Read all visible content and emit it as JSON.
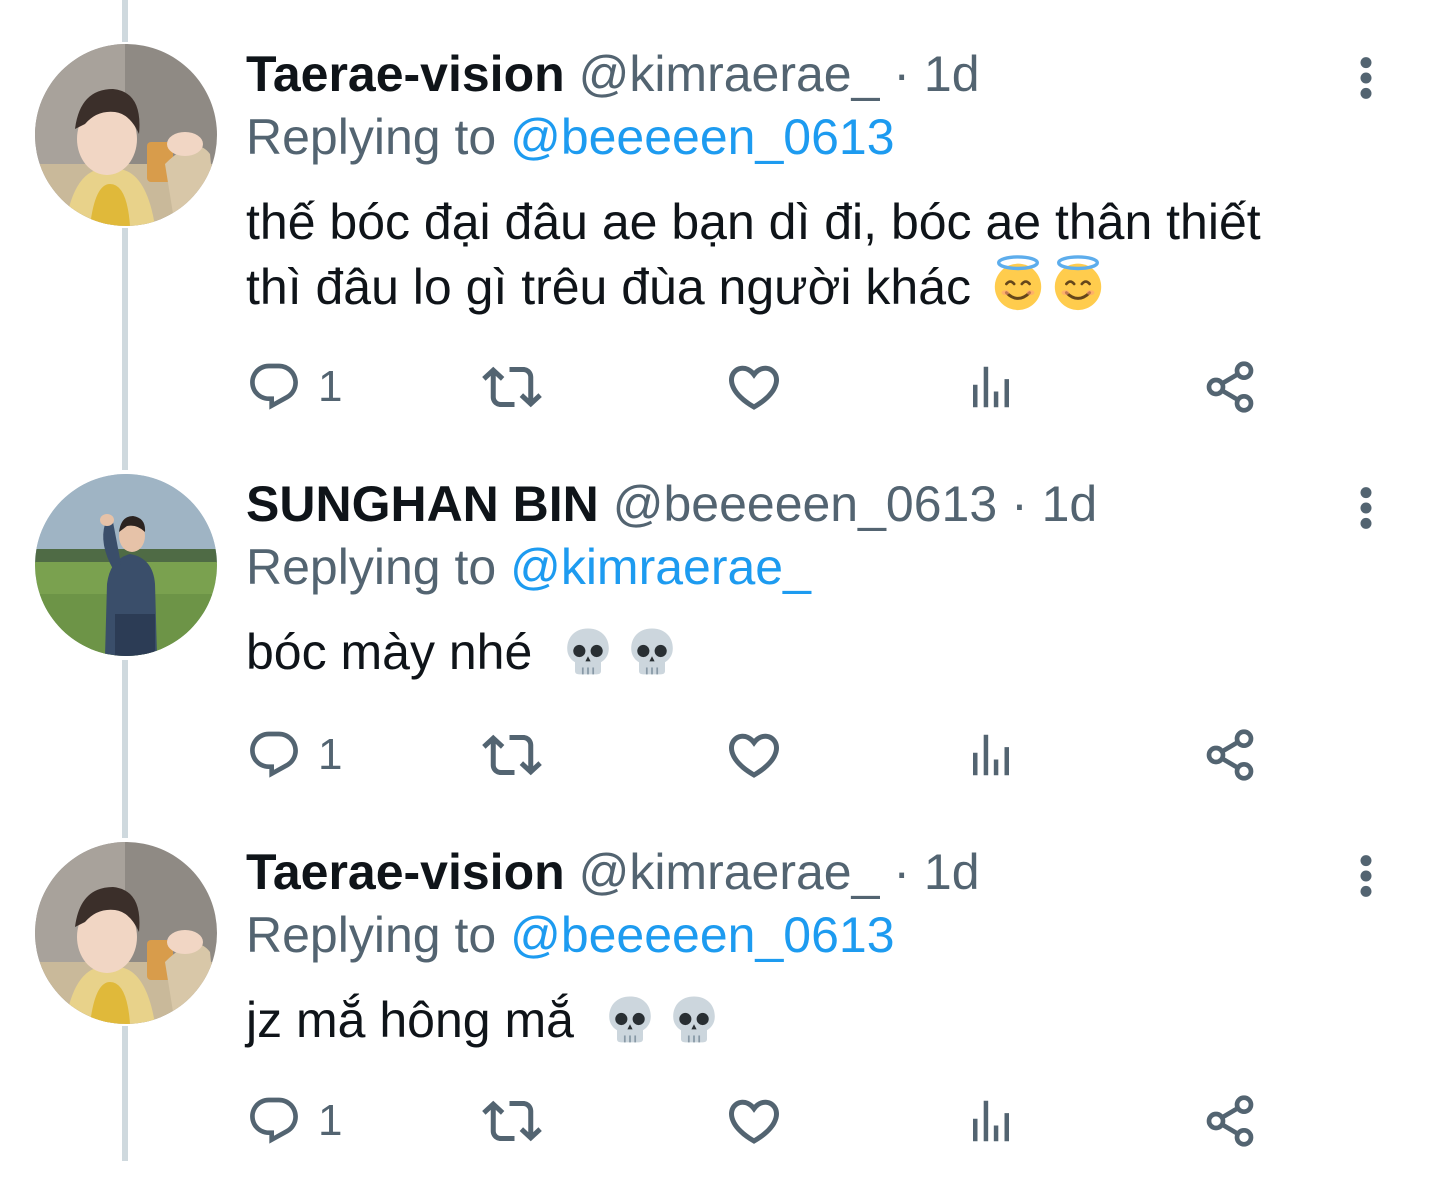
{
  "colors": {
    "text_primary": "#0f1419",
    "text_secondary": "#536471",
    "link": "#1d9bf0",
    "thread_line": "#cfd9de"
  },
  "icons": [
    "reply-icon",
    "retweet-icon",
    "like-icon",
    "analytics-icon",
    "share-icon",
    "more-options-icon",
    "halo-smile-emoji",
    "skull-emoji"
  ],
  "tweets": [
    {
      "name": "Taerae-vision",
      "handle": "@kimraerae_",
      "separator": "·",
      "time": "1d",
      "replying_prefix": "Replying to",
      "replying_to": "@beeeeen_0613",
      "text_line1": "thế bóc đại đâu ae bạn dì đi, bóc ae thân thiết",
      "text_line2": "thì đâu lo gì trêu đùa người khác",
      "emoji": [
        "halo-smile-emoji",
        "halo-smile-emoji"
      ],
      "reply_count": "1"
    },
    {
      "name": "SUNGHAN BIN",
      "handle": "@beeeeen_0613",
      "separator": "·",
      "time": "1d",
      "replying_prefix": "Replying to",
      "replying_to": "@kimraerae_",
      "text_line1": "bóc mày nhé",
      "emoji": [
        "skull-emoji",
        "skull-emoji"
      ],
      "reply_count": "1"
    },
    {
      "name": "Taerae-vision",
      "handle": "@kimraerae_",
      "separator": "·",
      "time": "1d",
      "replying_prefix": "Replying to",
      "replying_to": "@beeeeen_0613",
      "text_line1": "jz mắ hông mắ",
      "emoji": [
        "skull-emoji",
        "skull-emoji"
      ],
      "reply_count": "1"
    }
  ]
}
